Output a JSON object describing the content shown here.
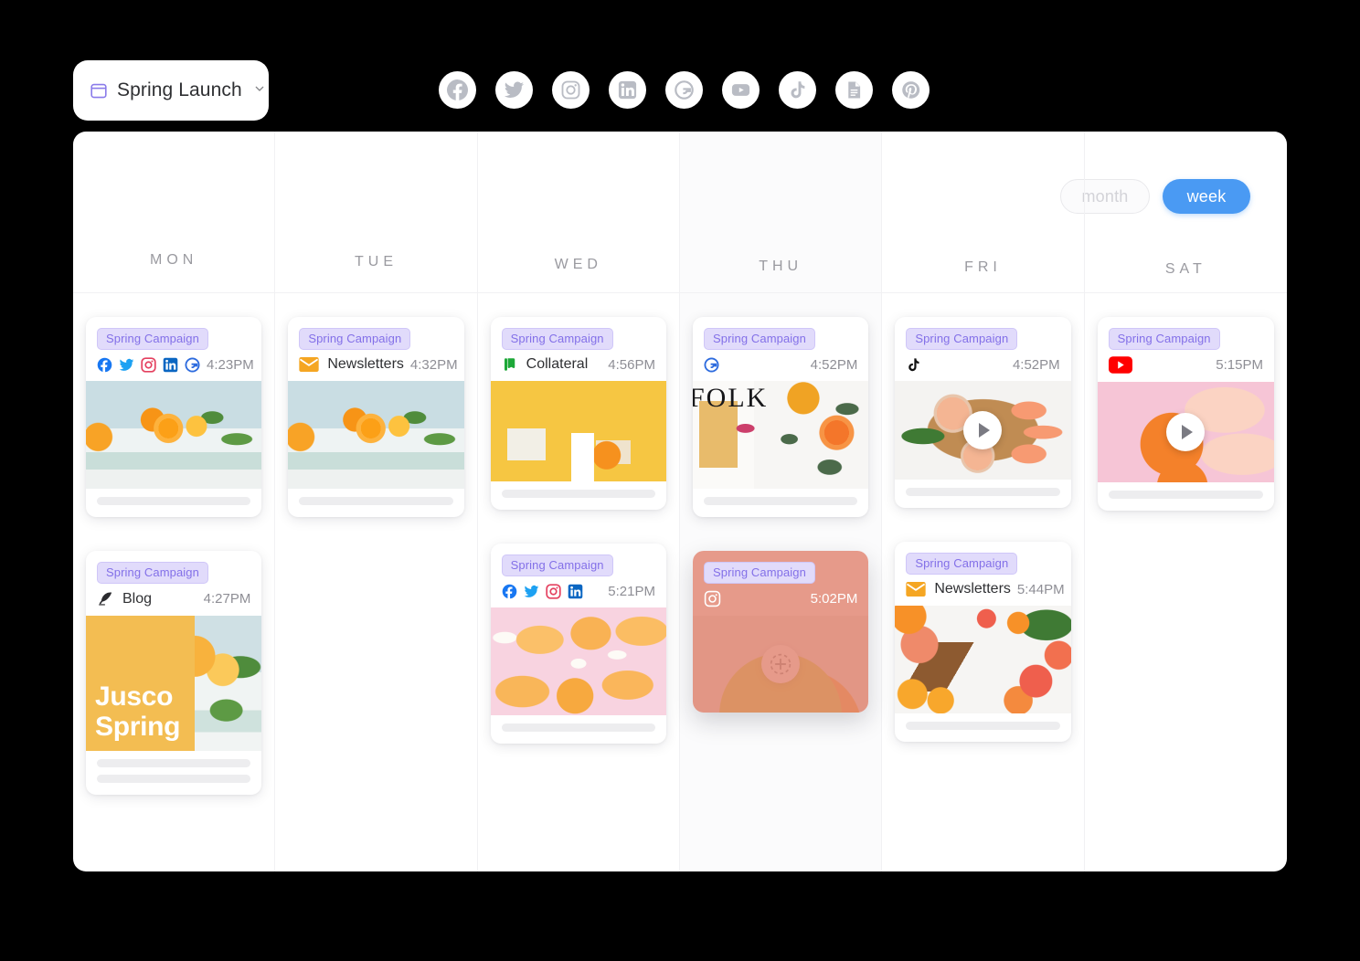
{
  "topbar": {
    "project": {
      "name": "Spring Launch",
      "icon": "calendar-icon",
      "chevron": "chevron-down-icon"
    },
    "channels": [
      {
        "name": "facebook",
        "label": "Facebook"
      },
      {
        "name": "twitter",
        "label": "Twitter"
      },
      {
        "name": "instagram",
        "label": "Instagram"
      },
      {
        "name": "linkedin",
        "label": "LinkedIn"
      },
      {
        "name": "google",
        "label": "Google"
      },
      {
        "name": "youtube",
        "label": "YouTube"
      },
      {
        "name": "tiktok",
        "label": "TikTok"
      },
      {
        "name": "blog",
        "label": "Blog"
      },
      {
        "name": "pinterest",
        "label": "Pinterest"
      }
    ]
  },
  "toolbar": {
    "month_label": "month",
    "week_label": "week",
    "active_view": "week",
    "active_color": "#4a9af3"
  },
  "badge": {
    "label": "Spring Campaign",
    "bg": "#e1dbfb",
    "text": "#8370e8"
  },
  "days": [
    {
      "label": "MON",
      "cards": [
        {
          "badge": "Spring Campaign",
          "channels": [
            "facebook",
            "twitter",
            "instagram",
            "linkedin",
            "google"
          ],
          "channel_label": "",
          "time": "4:23PM",
          "art": "art-oranges-blue",
          "bars": 1,
          "media": "image"
        },
        {
          "badge": "Spring Campaign",
          "channels": [
            "blog"
          ],
          "channel_label": "Blog",
          "time": "4:27PM",
          "art": "art-jusco",
          "overlay_text": "Jusco\nSpring",
          "bars": 2,
          "media": "image"
        }
      ]
    },
    {
      "label": "TUE",
      "cards": [
        {
          "badge": "Spring Campaign",
          "channels": [
            "newsletter"
          ],
          "channel_label": "Newsletters",
          "time": "4:32PM",
          "art": "art-oranges-blue",
          "bars": 1,
          "media": "image"
        }
      ]
    },
    {
      "label": "WED",
      "cards": [
        {
          "badge": "Spring Campaign",
          "channels": [
            "collateral"
          ],
          "channel_label": "Collateral",
          "time": "4:56PM",
          "art": "art-yellow-bottle",
          "bars": 1,
          "media": "image"
        },
        {
          "badge": "Spring Campaign",
          "channels": [
            "facebook",
            "twitter",
            "instagram",
            "linkedin"
          ],
          "channel_label": "",
          "time": "5:21PM",
          "art": "art-pink-mango",
          "bars": 1,
          "media": "image"
        }
      ]
    },
    {
      "label": "THU",
      "highlight": true,
      "cards": [
        {
          "badge": "Spring Campaign",
          "channels": [
            "google"
          ],
          "channel_label": "",
          "time": "4:52PM",
          "art": "art-folk",
          "overlay_text": "FOLK",
          "bars": 1,
          "media": "image"
        },
        {
          "badge": "Spring Campaign",
          "channels": [
            "instagram-outline"
          ],
          "channel_label": "",
          "time": "5:02PM",
          "art": "art-grapefruit",
          "bars": 0,
          "media": "image",
          "dragging": true,
          "tint": "#e08470",
          "drop_indicator": "add-circle-icon"
        }
      ]
    },
    {
      "label": "FRI",
      "cards": [
        {
          "badge": "Spring Campaign",
          "channels": [
            "tiktok"
          ],
          "channel_label": "",
          "time": "4:52PM",
          "art": "art-board",
          "bars": 1,
          "media": "video"
        },
        {
          "badge": "Spring Campaign",
          "channels": [
            "newsletter"
          ],
          "channel_label": "Newsletters",
          "time": "5:44PM",
          "art": "art-citrus-board",
          "bars": 1,
          "media": "image"
        }
      ]
    },
    {
      "label": "SAT",
      "cards": [
        {
          "badge": "Spring Campaign",
          "channels": [
            "youtube"
          ],
          "channel_label": "",
          "time": "5:15PM",
          "art": "art-pink-hand",
          "bars": 1,
          "media": "video"
        }
      ]
    }
  ]
}
